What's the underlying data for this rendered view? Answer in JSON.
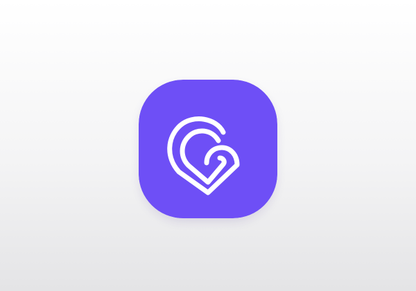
{
  "icon": {
    "name": "location-pin-c-logo-icon",
    "background_color": "#6e4ff6",
    "glyph_color": "#ffffff",
    "page_background_top": "#ffffff",
    "page_background_bottom": "#e4e4e6"
  }
}
